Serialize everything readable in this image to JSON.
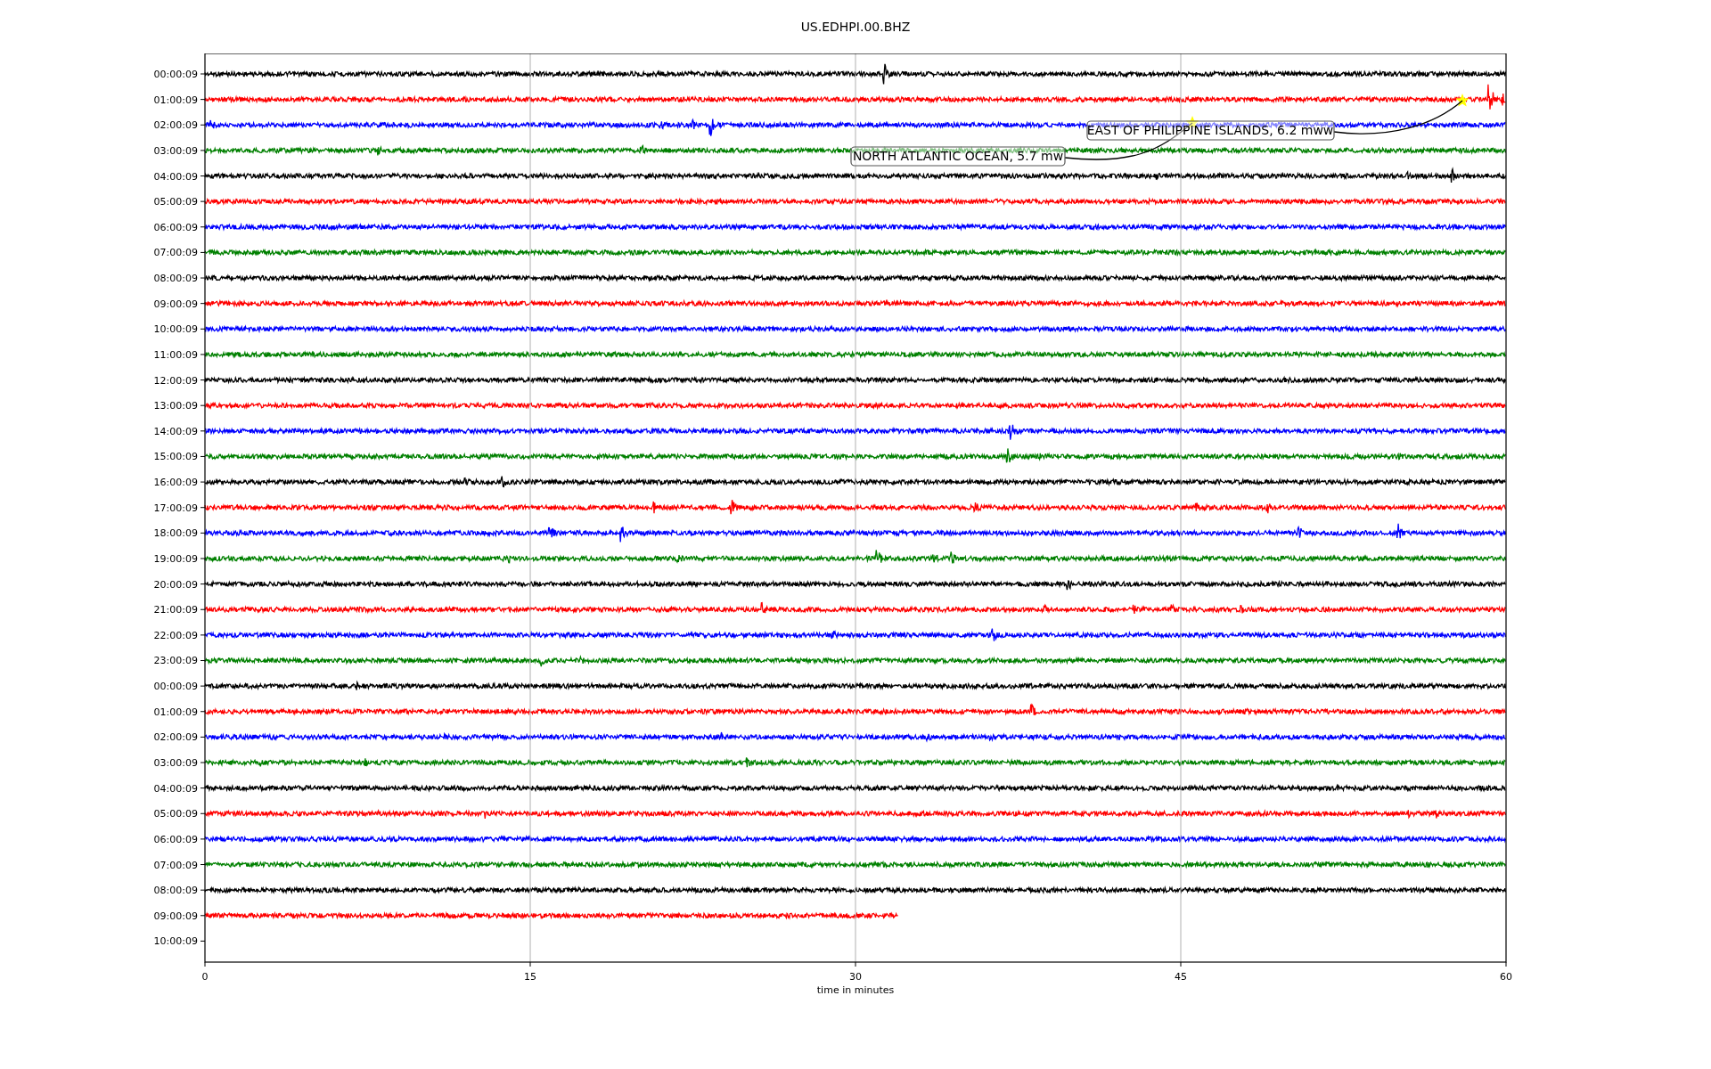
{
  "figure": {
    "title": "US.EDHPI.00.BHZ",
    "xlabel": "time in minutes",
    "xticks": [
      "0",
      "15",
      "30",
      "45",
      "60"
    ],
    "rows": [
      {
        "label": "00:00:09",
        "color": "#000000",
        "kind": "full"
      },
      {
        "label": "01:00:09",
        "color": "#ff0000",
        "kind": "full"
      },
      {
        "label": "02:00:09",
        "color": "#0000ff",
        "kind": "full"
      },
      {
        "label": "03:00:09",
        "color": "#008000",
        "kind": "full"
      },
      {
        "label": "04:00:09",
        "color": "#000000",
        "kind": "full"
      },
      {
        "label": "05:00:09",
        "color": "#ff0000",
        "kind": "full"
      },
      {
        "label": "06:00:09",
        "color": "#0000ff",
        "kind": "full"
      },
      {
        "label": "07:00:09",
        "color": "#008000",
        "kind": "full"
      },
      {
        "label": "08:00:09",
        "color": "#000000",
        "kind": "full"
      },
      {
        "label": "09:00:09",
        "color": "#ff0000",
        "kind": "full"
      },
      {
        "label": "10:00:09",
        "color": "#0000ff",
        "kind": "full"
      },
      {
        "label": "11:00:09",
        "color": "#008000",
        "kind": "full"
      },
      {
        "label": "12:00:09",
        "color": "#000000",
        "kind": "full"
      },
      {
        "label": "13:00:09",
        "color": "#ff0000",
        "kind": "full"
      },
      {
        "label": "14:00:09",
        "color": "#0000ff",
        "kind": "full"
      },
      {
        "label": "15:00:09",
        "color": "#008000",
        "kind": "full"
      },
      {
        "label": "16:00:09",
        "color": "#000000",
        "kind": "full"
      },
      {
        "label": "17:00:09",
        "color": "#ff0000",
        "kind": "full"
      },
      {
        "label": "18:00:09",
        "color": "#0000ff",
        "kind": "full"
      },
      {
        "label": "19:00:09",
        "color": "#008000",
        "kind": "full"
      },
      {
        "label": "20:00:09",
        "color": "#000000",
        "kind": "full"
      },
      {
        "label": "21:00:09",
        "color": "#ff0000",
        "kind": "full"
      },
      {
        "label": "22:00:09",
        "color": "#0000ff",
        "kind": "full"
      },
      {
        "label": "23:00:09",
        "color": "#008000",
        "kind": "full"
      },
      {
        "label": "00:00:09",
        "color": "#000000",
        "kind": "full"
      },
      {
        "label": "01:00:09",
        "color": "#ff0000",
        "kind": "full"
      },
      {
        "label": "02:00:09",
        "color": "#0000ff",
        "kind": "full"
      },
      {
        "label": "03:00:09",
        "color": "#008000",
        "kind": "full"
      },
      {
        "label": "04:00:09",
        "color": "#000000",
        "kind": "full"
      },
      {
        "label": "05:00:09",
        "color": "#ff0000",
        "kind": "full"
      },
      {
        "label": "06:00:09",
        "color": "#0000ff",
        "kind": "full"
      },
      {
        "label": "07:00:09",
        "color": "#008000",
        "kind": "full"
      },
      {
        "label": "08:00:09",
        "color": "#000000",
        "kind": "full"
      },
      {
        "label": "09:00:09",
        "color": "#ff0000",
        "kind": "partial"
      },
      {
        "label": "10:00:09",
        "kind": "empty"
      }
    ],
    "annotations": [
      {
        "text": "EAST OF PHILIPPINE ISLANDS, 6.2 mww"
      },
      {
        "text": "NORTH ATLANTIC OCEAN, 5.7 mw"
      }
    ]
  }
}
